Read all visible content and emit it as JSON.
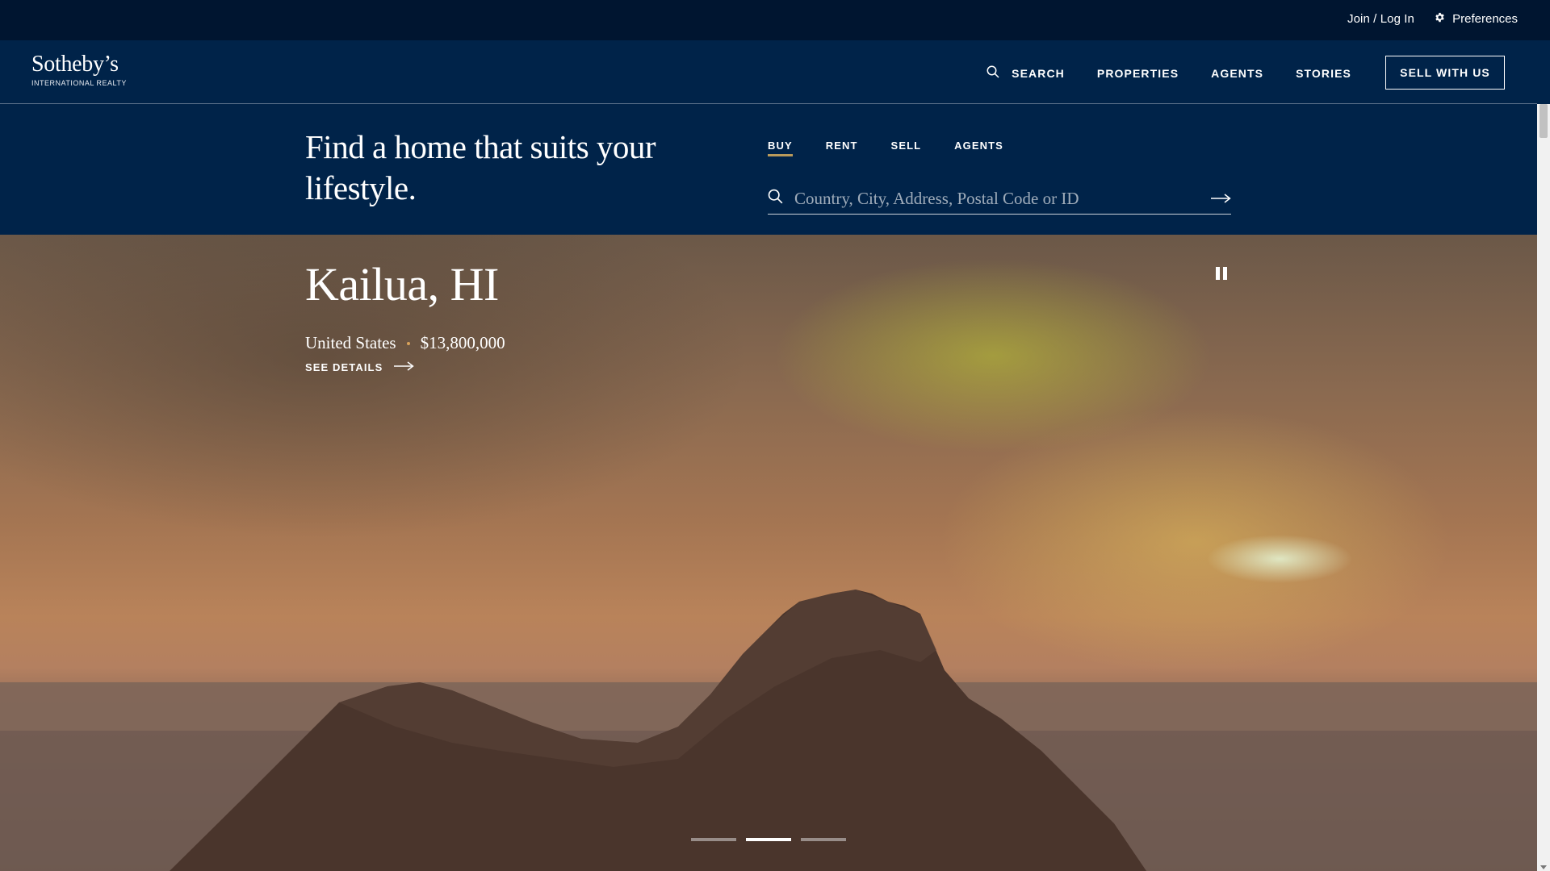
{
  "topbar": {
    "join_label": "Join / Log In",
    "preferences_label": "Preferences"
  },
  "logo": {
    "name": "Sotheby’s",
    "subtitle": "INTERNATIONAL REALTY"
  },
  "nav": {
    "search_label": "SEARCH",
    "properties_label": "PROPERTIES",
    "agents_label": "AGENTS",
    "stories_label": "STORIES",
    "sell_button_label": "SELL WITH US"
  },
  "finder": {
    "headline": "Find a home that suits your lifestyle.",
    "tabs": [
      {
        "label": "BUY",
        "active": true
      },
      {
        "label": "RENT",
        "active": false
      },
      {
        "label": "SELL",
        "active": false
      },
      {
        "label": "AGENTS",
        "active": false
      }
    ],
    "search_placeholder": "Country, City, Address, Postal Code or ID",
    "search_value": ""
  },
  "hero": {
    "city": "Kailua, HI",
    "country": "United States",
    "price": "$13,800,000",
    "details_label": "SEE DETAILS",
    "slides_total": 3,
    "active_slide": 2
  },
  "colors": {
    "navy": "#002349",
    "topbar": "#001530",
    "accent_gold": "#b99a5b"
  }
}
